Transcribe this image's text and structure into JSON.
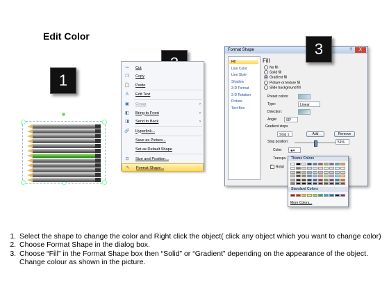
{
  "title": "Edit Color",
  "steps_badges": [
    "1",
    "2",
    "3"
  ],
  "context_menu": {
    "items": [
      {
        "label": "Cut",
        "icon": "scissors-icon",
        "glyph": "✂",
        "disabled": false,
        "submenu": false
      },
      {
        "label": "Copy",
        "icon": "copy-icon",
        "glyph": "❐",
        "disabled": false,
        "submenu": false
      },
      {
        "label": "Paste",
        "icon": "paste-icon",
        "glyph": "📋",
        "disabled": false,
        "submenu": false
      },
      {
        "label": "Edit Text",
        "icon": "edit-text-icon",
        "glyph": "A",
        "disabled": false,
        "submenu": false
      },
      {
        "label": "Group",
        "icon": "group-icon",
        "glyph": "▣",
        "disabled": true,
        "submenu": true
      },
      {
        "label": "Bring to Front",
        "icon": "bring-front-icon",
        "glyph": "◧",
        "disabled": false,
        "submenu": true
      },
      {
        "label": "Send to Back",
        "icon": "send-back-icon",
        "glyph": "◨",
        "disabled": false,
        "submenu": true
      },
      {
        "label": "Hyperlink...",
        "icon": "hyperlink-icon",
        "glyph": "🔗",
        "disabled": false,
        "submenu": false
      },
      {
        "label": "Save as Picture...",
        "icon": "",
        "glyph": "",
        "disabled": false,
        "submenu": false
      },
      {
        "label": "Set as Default Shape",
        "icon": "",
        "glyph": "",
        "disabled": false,
        "submenu": false
      },
      {
        "label": "Size and Position...",
        "icon": "size-icon",
        "glyph": "⊡",
        "disabled": false,
        "submenu": false
      },
      {
        "label": "Format Shape...",
        "icon": "format-shape-icon",
        "glyph": "✎",
        "disabled": false,
        "submenu": false,
        "highlighted": true
      }
    ]
  },
  "dialog": {
    "title": "Format Shape",
    "help": "?",
    "close": "X",
    "nav": [
      "Fill",
      "Line Color",
      "Line Style",
      "Shadow",
      "3-D Format",
      "3-D Rotation",
      "Picture",
      "Text Box"
    ],
    "section": "Fill",
    "fill_options": [
      {
        "label": "No fill",
        "checked": false
      },
      {
        "label": "Solid fill",
        "checked": false
      },
      {
        "label": "Gradient fill",
        "checked": true
      },
      {
        "label": "Picture or texture fill",
        "checked": false
      },
      {
        "label": "Slide background fill",
        "checked": false
      }
    ],
    "preset_colors_label": "Preset colors:",
    "type_label": "Type:",
    "type_value": "Linear",
    "direction_label": "Direction:",
    "angle_label": "Angle:",
    "angle_value": "90°",
    "gradient_stops_label": "Gradient stops",
    "stop_value": "Stop 1",
    "add_label": "Add",
    "remove_label": "Remove",
    "stop_position_label": "Stop position:",
    "stop_position_value": "51%",
    "color_label": "Color:",
    "transparency_label": "Transpa",
    "rotate_label": "Rotat",
    "rotate_checked": true
  },
  "palette": {
    "theme_header": "Theme Colors",
    "standard_header": "Standard Colors",
    "more_label": "More Colors...",
    "theme_top": [
      "#ffffff",
      "#000000",
      "#eeece1",
      "#1f497d",
      "#4f81bd",
      "#c0504d",
      "#9bbb59",
      "#8064a2",
      "#4bacc6",
      "#f79646"
    ],
    "theme_shades": [
      [
        "#f2f2f2",
        "#7f7f7f",
        "#ddd9c3",
        "#c6d9f0",
        "#dbe5f1",
        "#f2dcdb",
        "#ebf1dd",
        "#e5e0ec",
        "#dbeef3",
        "#fdeada"
      ],
      [
        "#d8d8d8",
        "#595959",
        "#c4bd97",
        "#8db3e2",
        "#b8cce4",
        "#e5b9b7",
        "#d7e3bc",
        "#ccc1d9",
        "#b7dde8",
        "#fbd5b5"
      ],
      [
        "#bfbfbf",
        "#3f3f3f",
        "#938953",
        "#548dd4",
        "#95b3d7",
        "#d99694",
        "#c3d69b",
        "#b2a2c7",
        "#92cddc",
        "#fac08f"
      ],
      [
        "#a5a5a5",
        "#262626",
        "#494429",
        "#17365d",
        "#366092",
        "#953734",
        "#76923c",
        "#5f497a",
        "#31859b",
        "#e36c09"
      ],
      [
        "#7f7f7f",
        "#0c0c0c",
        "#1d1b10",
        "#0f243e",
        "#244061",
        "#632423",
        "#4f6128",
        "#3f3151",
        "#205867",
        "#974806"
      ]
    ],
    "standard": [
      "#c00000",
      "#ff0000",
      "#ffc000",
      "#ffff00",
      "#92d050",
      "#00b050",
      "#00b0f0",
      "#0070c0",
      "#002060",
      "#7030a0"
    ]
  },
  "instructions": [
    "Select the shape to change the color and Right click the object( click any object which you want to change color)",
    "Choose Format Shape in the dialog box.",
    "Choose “Fill” in the Format Shape box then “Solid” or “Gradient” depending on the appearance of the object. Change colour as shown in the picture."
  ],
  "pencils": {
    "count": 12,
    "highlighted_index": 6,
    "highlight_color": "#4cae2b"
  }
}
